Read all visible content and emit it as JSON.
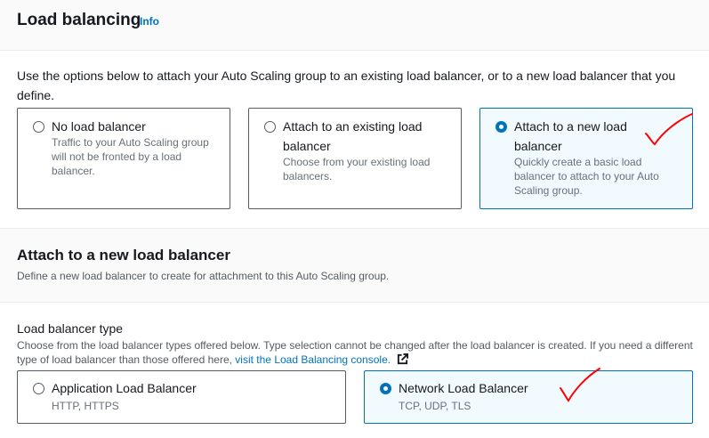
{
  "header": {
    "title": "Load balancing",
    "info_link": "Info"
  },
  "intro": "Use the options below to attach your Auto Scaling group to an existing load balancer, or to a new load balancer that you define.",
  "lb_options": [
    {
      "label": "No load balancer",
      "description": "Traffic to your Auto Scaling group will not be fronted by a load balancer.",
      "selected": false
    },
    {
      "label": "Attach to an existing load balancer",
      "description": "Choose from your existing load balancers.",
      "selected": false
    },
    {
      "label": "Attach to a new load balancer",
      "description": "Quickly create a basic load balancer to attach to your Auto Scaling group.",
      "selected": true
    }
  ],
  "new_lb": {
    "title": "Attach to a new load balancer",
    "description": "Define a new load balancer to create for attachment to this Auto Scaling group."
  },
  "lb_type": {
    "label": "Load balancer type",
    "description": "Choose from the load balancer types offered below. Type selection cannot be changed after the load balancer is created. If you need a different type of load balancer than those offered here,",
    "link_text": "visit the Load Balancing console.",
    "options": [
      {
        "label": "Application Load Balancer",
        "protocols": "HTTP, HTTPS",
        "selected": false
      },
      {
        "label": "Network Load Balancer",
        "protocols": "TCP, UDP, TLS",
        "selected": true
      }
    ]
  },
  "colors": {
    "accent": "#0073bb",
    "annotation": "#ff0000",
    "selected_bg": "#f1faff"
  },
  "icons": [
    "external-link-icon",
    "checkmark-annotation"
  ]
}
